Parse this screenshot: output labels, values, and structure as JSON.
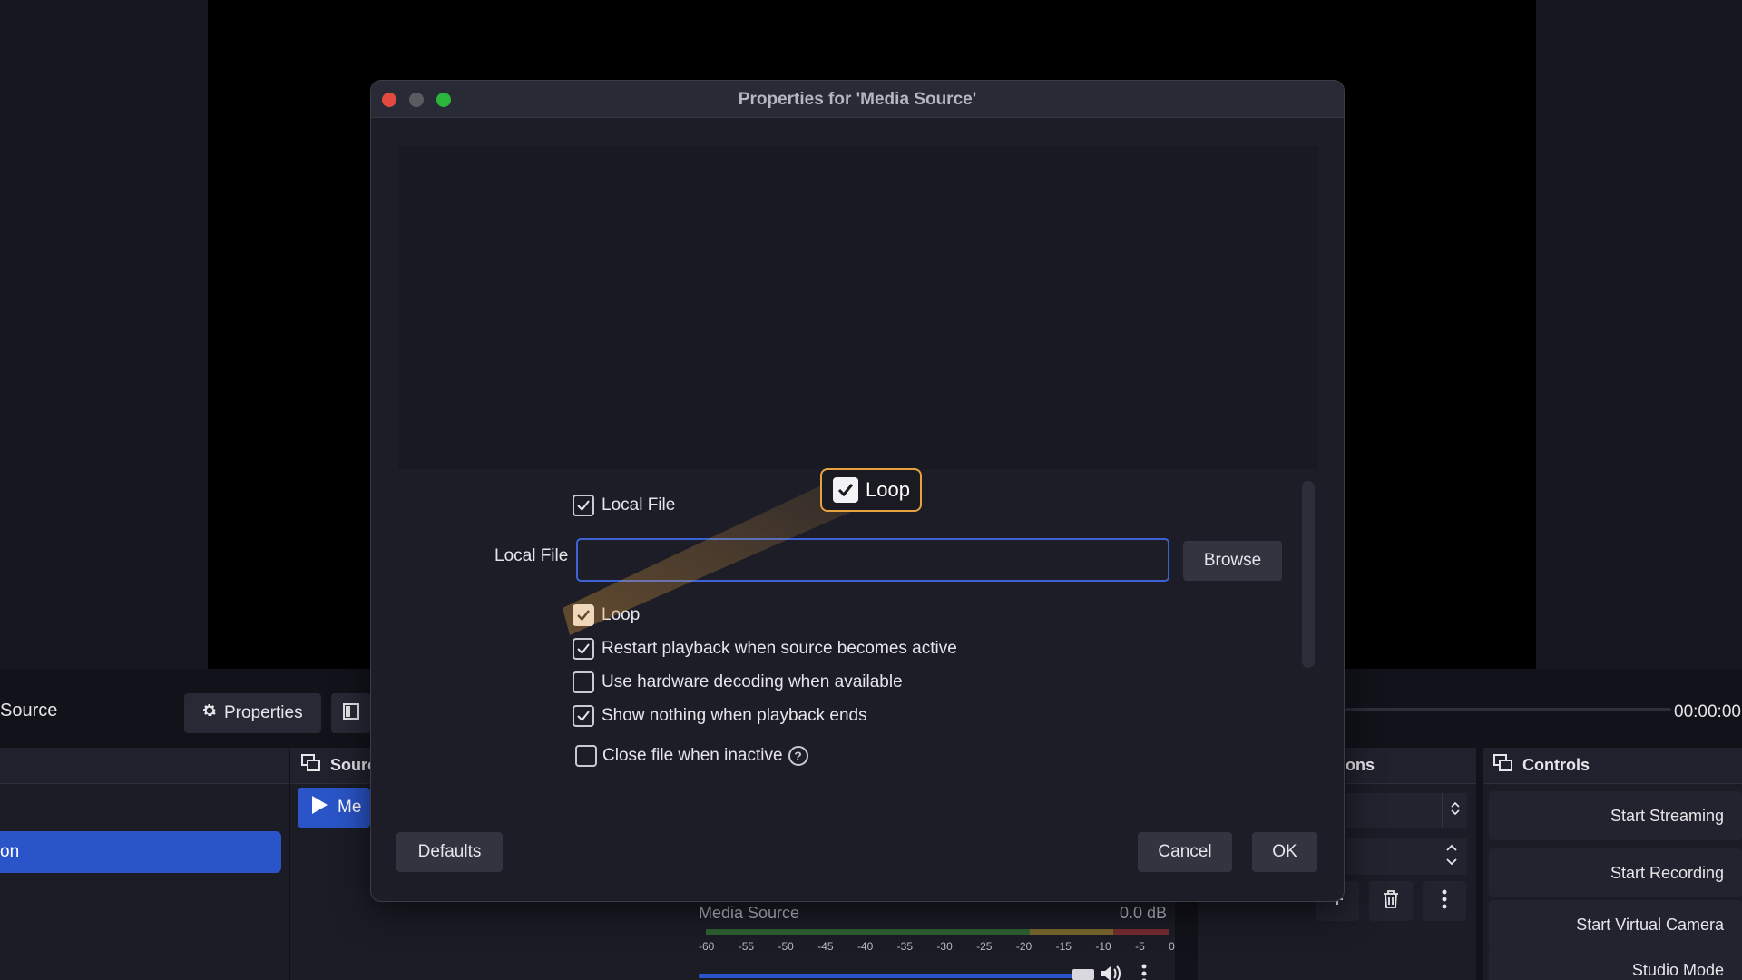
{
  "main": {
    "source_label": "Source",
    "properties_button": "Properties",
    "time": "00:00:00",
    "scene_item": "on",
    "sources_panel_title": "Sourc",
    "sources_item": "Me",
    "transitions_panel_title": "ons",
    "controls_panel_title": "Controls",
    "controls": {
      "start_streaming": "Start Streaming",
      "start_recording": "Start Recording",
      "start_virtual_camera": "Start Virtual Camera",
      "studio_mode": "Studio Mode"
    },
    "mixer": {
      "source_name": "Media Source",
      "level": "0.0 dB",
      "ticks": [
        "-60",
        "-55",
        "-50",
        "-45",
        "-40",
        "-35",
        "-30",
        "-25",
        "-20",
        "-15",
        "-10",
        "-5",
        "0"
      ]
    }
  },
  "dialog": {
    "title": "Properties for 'Media Source'",
    "local_file_checkbox": {
      "label": "Local File",
      "checked": true
    },
    "local_file_field": {
      "label": "Local File",
      "value": "",
      "placeholder": ""
    },
    "browse_button": "Browse",
    "options": [
      {
        "label": "Loop",
        "checked": true
      },
      {
        "label": "Restart playback when source becomes active",
        "checked": true
      },
      {
        "label": "Use hardware decoding when available",
        "checked": false
      },
      {
        "label": "Show nothing when playback ends",
        "checked": true
      },
      {
        "label": "Close file when inactive",
        "checked": false
      }
    ],
    "defaults_button": "Defaults",
    "cancel_button": "Cancel",
    "ok_button": "OK"
  },
  "callout": {
    "label": "Loop",
    "checked": true,
    "accent": "#e7a13f"
  },
  "colors": {
    "accent_blue": "#2a55c8",
    "close": "#e2493f",
    "minimize": "#5a5b62",
    "zoom": "#2cb53c"
  }
}
